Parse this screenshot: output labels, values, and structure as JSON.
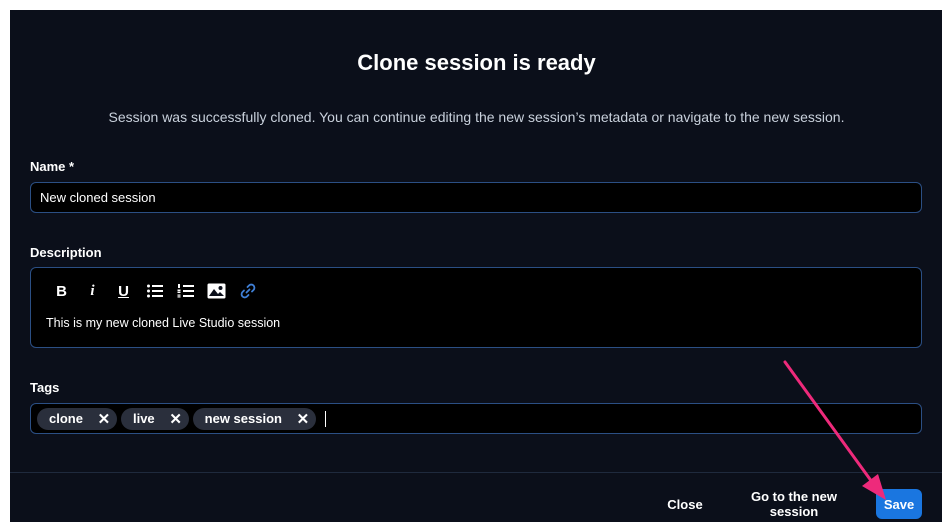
{
  "dialog": {
    "title": "Clone session is ready",
    "subtitle": "Session was successfully cloned. You can continue editing the new session’s metadata or navigate to the new session."
  },
  "name_field": {
    "label": "Name *",
    "value": "New cloned session"
  },
  "description_field": {
    "label": "Description",
    "toolbar": {
      "bold": "B",
      "italic": "i",
      "underline": "U",
      "bullet_list_icon": "bullet-list-icon",
      "numbered_list_icon": "numbered-list-icon",
      "image_icon": "image-icon",
      "link_icon": "link-icon"
    },
    "value": "This is my new cloned Live Studio session"
  },
  "tags_field": {
    "label": "Tags",
    "tags": [
      {
        "label": "clone",
        "remove": "✕"
      },
      {
        "label": "live",
        "remove": "✕"
      },
      {
        "label": "new session",
        "remove": "✕"
      }
    ]
  },
  "footer": {
    "close_label": "Close",
    "goto_label": "Go to the new session",
    "save_label": "Save"
  },
  "colors": {
    "background": "#0b0f1a",
    "input_border": "#2b4f84",
    "primary": "#1a76e0",
    "link_icon": "#3f7fd6",
    "annotation_arrow": "#ee2a7b"
  }
}
